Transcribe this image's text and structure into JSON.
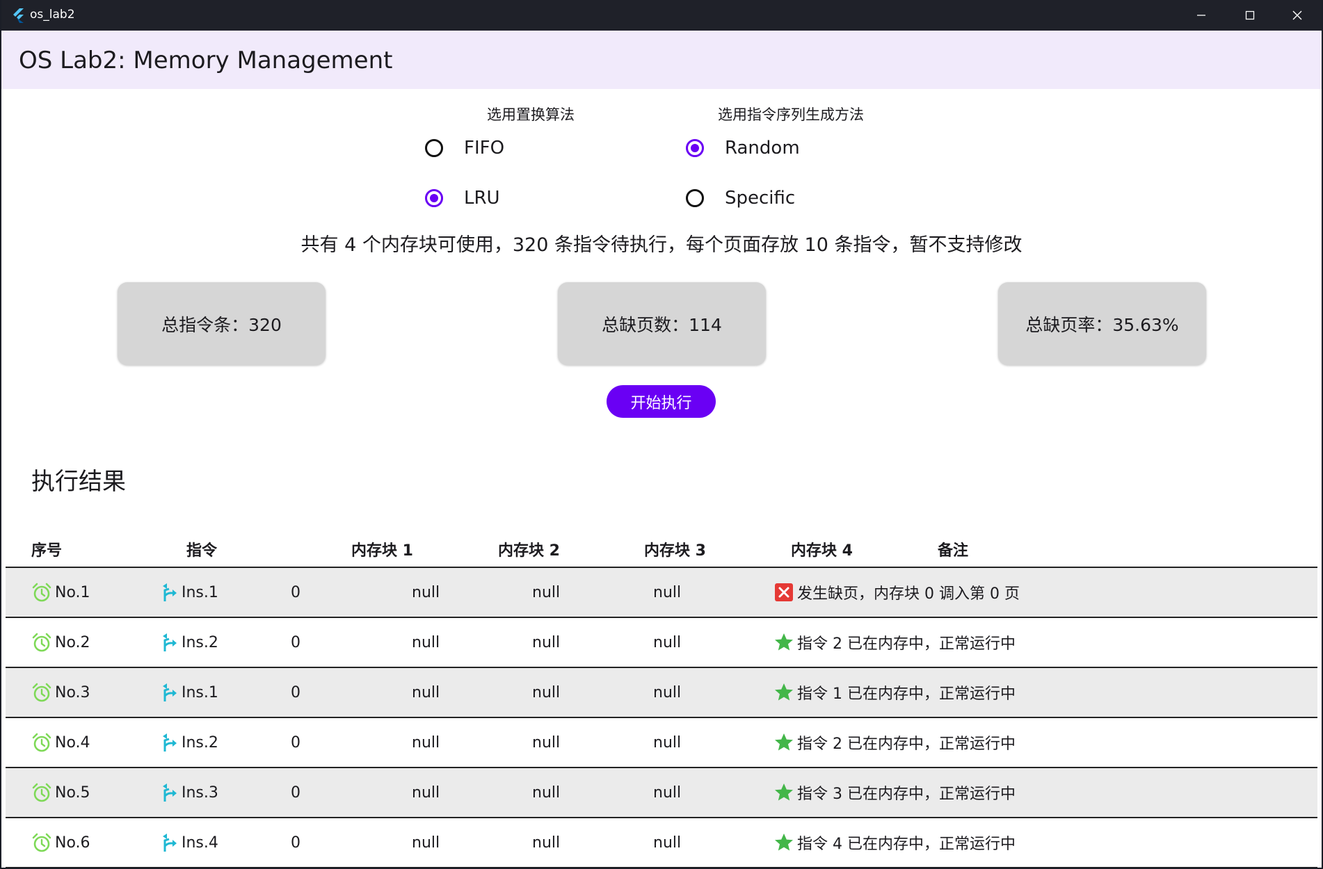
{
  "window": {
    "title": "os_lab2"
  },
  "appbar": {
    "title": "OS Lab2: Memory Management"
  },
  "algorithm": {
    "title": "选用置换算法",
    "options": [
      {
        "label": "FIFO",
        "selected": false
      },
      {
        "label": "LRU",
        "selected": true
      }
    ]
  },
  "sequence": {
    "title": "选用指令序列生成方法",
    "options": [
      {
        "label": "Random",
        "selected": true
      },
      {
        "label": "Specific",
        "selected": false
      }
    ]
  },
  "info": "共有 4 个内存块可使用，320 条指令待执行，每个页面存放 10 条指令，暂不支持修改",
  "stats": {
    "total_instructions": "总指令条：320",
    "total_page_faults": "总缺页数：114",
    "page_fault_rate": "总缺页率：35.63%"
  },
  "start_button": "开始执行",
  "results": {
    "title": "执行结果",
    "columns": [
      "序号",
      "指令",
      "内存块 1",
      "内存块 2",
      "内存块 3",
      "内存块 4",
      "备注"
    ],
    "rows": [
      {
        "no": "No.1",
        "ins": "Ins.1",
        "b1": "0",
        "b2": "null",
        "b3": "null",
        "b4": "null",
        "status": "fault",
        "note": "发生缺页，内存块 0 调入第 0 页"
      },
      {
        "no": "No.2",
        "ins": "Ins.2",
        "b1": "0",
        "b2": "null",
        "b3": "null",
        "b4": "null",
        "status": "ok",
        "note": "指令 2 已在内存中，正常运行中"
      },
      {
        "no": "No.3",
        "ins": "Ins.1",
        "b1": "0",
        "b2": "null",
        "b3": "null",
        "b4": "null",
        "status": "ok",
        "note": "指令 1 已在内存中，正常运行中"
      },
      {
        "no": "No.4",
        "ins": "Ins.2",
        "b1": "0",
        "b2": "null",
        "b3": "null",
        "b4": "null",
        "status": "ok",
        "note": "指令 2 已在内存中，正常运行中"
      },
      {
        "no": "No.5",
        "ins": "Ins.3",
        "b1": "0",
        "b2": "null",
        "b3": "null",
        "b4": "null",
        "status": "ok",
        "note": "指令 3 已在内存中，正常运行中"
      },
      {
        "no": "No.6",
        "ins": "Ins.4",
        "b1": "0",
        "b2": "null",
        "b3": "null",
        "b4": "null",
        "status": "ok",
        "note": "指令 4 已在内存中，正常运行中"
      }
    ]
  },
  "colors": {
    "accent": "#6a00f4",
    "appbar_bg": "#f1eafb",
    "alarm_icon": "#7ed957",
    "instruction_icon": "#1fb8d3",
    "ok_icon": "#43b649",
    "fault_icon": "#e53935"
  },
  "icons": {
    "row_number": "alarm-clock-icon",
    "instruction": "turn-right-arrow-icon",
    "ok": "star-icon",
    "fault": "close-box-icon"
  }
}
